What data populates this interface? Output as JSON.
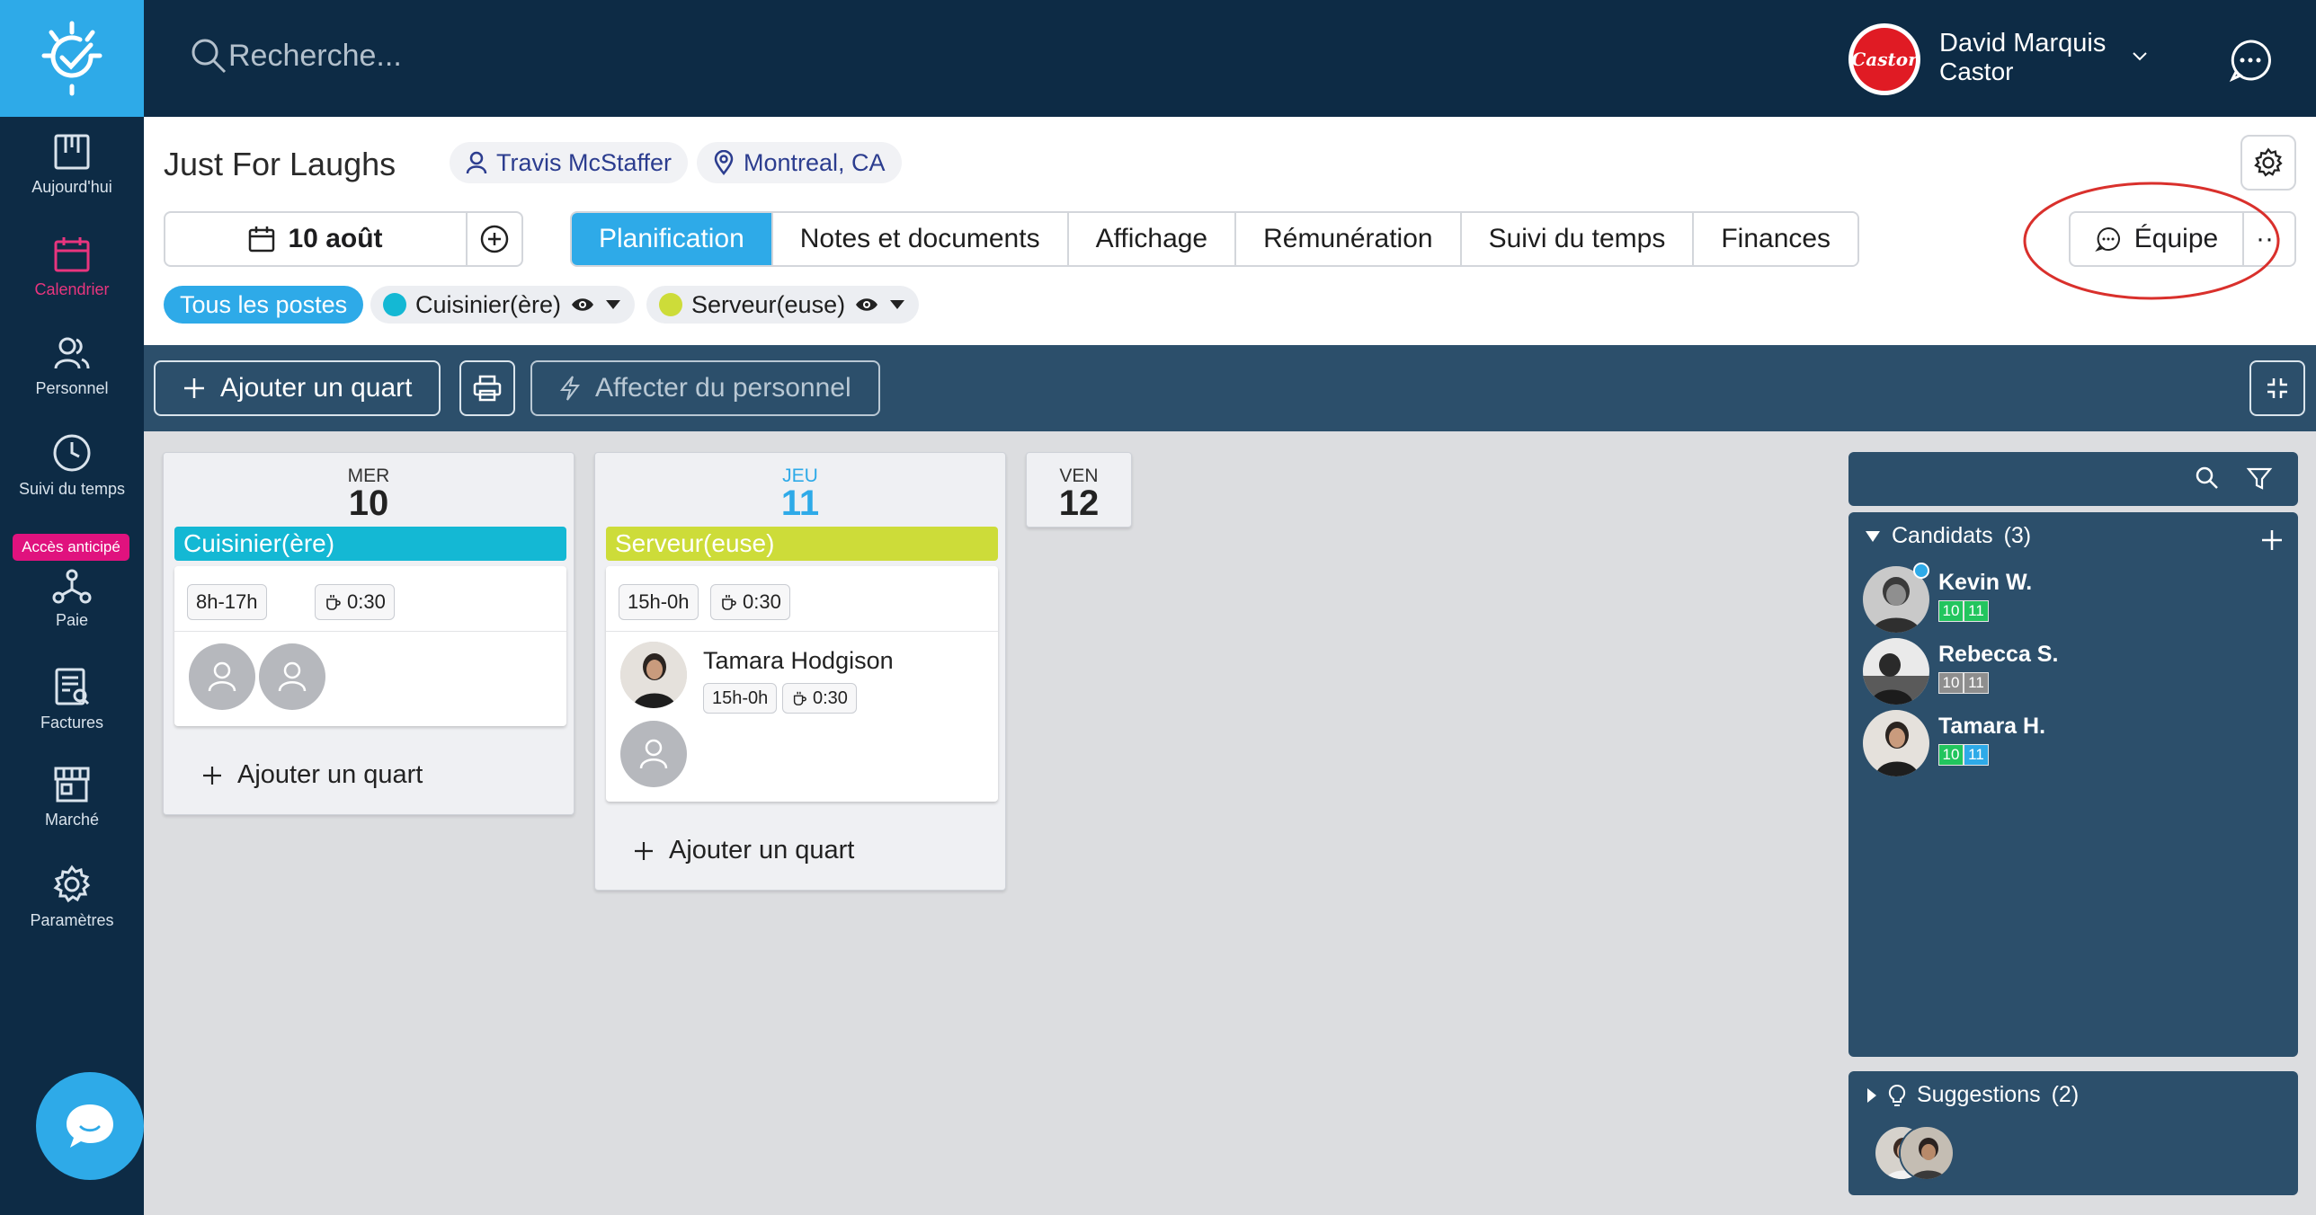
{
  "app": {
    "name": "Castor"
  },
  "sidebar": {
    "items": [
      {
        "label": "Aujourd'hui",
        "icon": "board-icon"
      },
      {
        "label": "Calendrier",
        "icon": "calendar-icon",
        "active": true
      },
      {
        "label": "Personnel",
        "icon": "people-icon"
      },
      {
        "label": "Suivi du temps",
        "icon": "clock-icon"
      },
      {
        "label": "Paie",
        "icon": "payroll-icon"
      },
      {
        "label": "Factures",
        "icon": "invoice-icon"
      },
      {
        "label": "Marché",
        "icon": "store-icon"
      },
      {
        "label": "Paramètres",
        "icon": "gear-icon"
      }
    ],
    "early_access_badge": "Accès anticipé"
  },
  "topbar": {
    "search_placeholder": "Recherche...",
    "user": {
      "name": "David Marquis",
      "org": "Castor"
    },
    "logo_text": "Castor"
  },
  "event": {
    "title": "Just For Laughs",
    "manager": "Travis McStaffer",
    "location": "Montreal, CA"
  },
  "date_selector": {
    "label": "10 août"
  },
  "tabs": [
    {
      "label": "Planification",
      "active": true
    },
    {
      "label": "Notes et documents"
    },
    {
      "label": "Affichage"
    },
    {
      "label": "Rémunération"
    },
    {
      "label": "Suivi du temps"
    },
    {
      "label": "Finances"
    }
  ],
  "team_button": {
    "label": "Équipe"
  },
  "more_button": {
    "label": "···"
  },
  "filters": [
    {
      "label": "Tous les postes",
      "active": true
    },
    {
      "label": "Cuisinier(ère)",
      "color": "#14b8d4"
    },
    {
      "label": "Serveur(euse)",
      "color": "#cddc39"
    }
  ],
  "toolbar": {
    "add_shift": "Ajouter un quart",
    "assign_staff": "Affecter du personnel"
  },
  "days": [
    {
      "dow": "MER",
      "num": "10",
      "highlight": false,
      "position": {
        "label": "Cuisinier(ère)",
        "color": "#14b8d4"
      },
      "time": "8h-17h",
      "break": "0:30",
      "add_label": "Ajouter un quart"
    },
    {
      "dow": "JEU",
      "num": "11",
      "highlight": true,
      "position": {
        "label": "Serveur(euse)",
        "color": "#cddc39"
      },
      "time": "15h-0h",
      "break": "0:30",
      "assignee": {
        "name": "Tamara Hodgison",
        "time": "15h-0h",
        "break": "0:30"
      },
      "add_label": "Ajouter un quart"
    },
    {
      "dow": "VEN",
      "num": "12",
      "highlight": false
    }
  ],
  "candidates": {
    "title": "Candidats",
    "count": "(3)",
    "list": [
      {
        "name": "Kevin W.",
        "d1": "10",
        "d2": "11",
        "c1": "#22c55e",
        "c2": "#22c55e"
      },
      {
        "name": "Rebecca S.",
        "d1": "10",
        "d2": "11",
        "c1": "#8e8e8e",
        "c2": "#8e8e8e"
      },
      {
        "name": "Tamara H.",
        "d1": "10",
        "d2": "11",
        "c1": "#22c55e",
        "c2": "#2eaae8"
      }
    ]
  },
  "suggestions": {
    "title": "Suggestions",
    "count": "(2)"
  }
}
